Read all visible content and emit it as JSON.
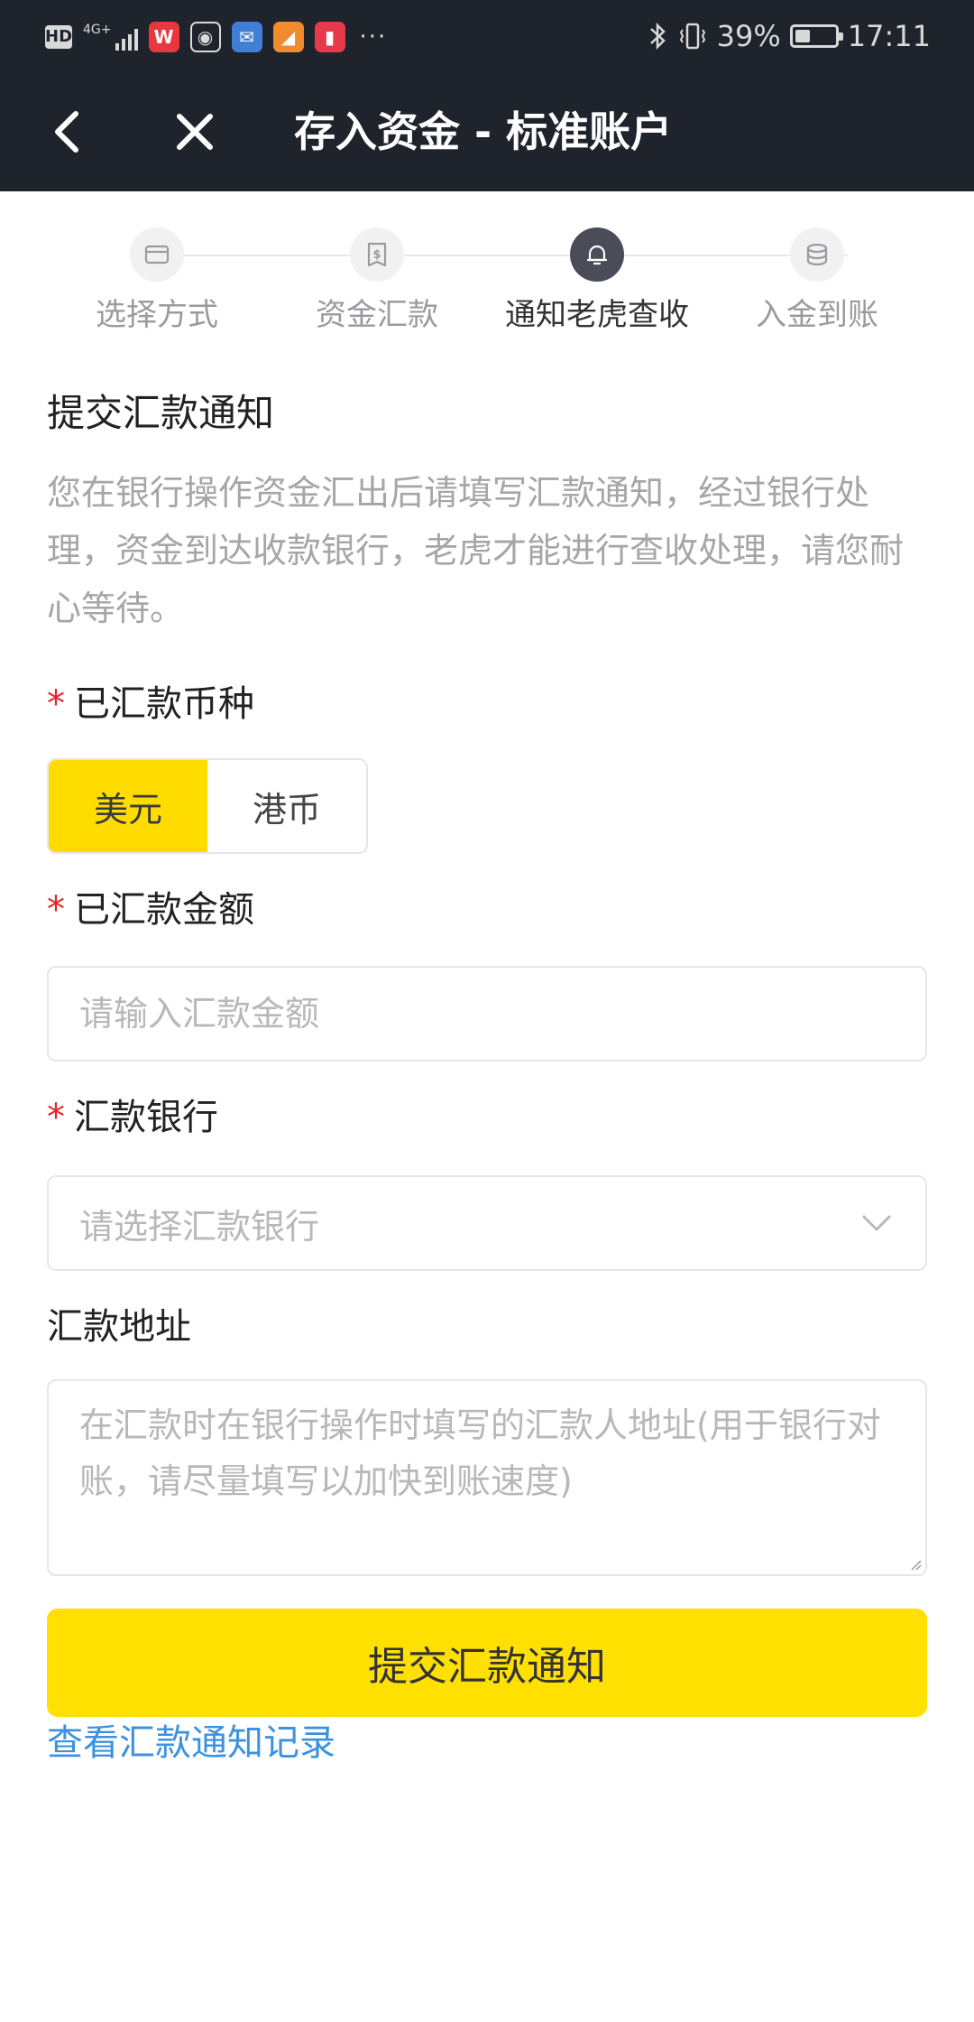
{
  "status_bar": {
    "hd": "HD",
    "network": "4G+",
    "apps": [
      {
        "icon": "wps-app-icon",
        "glyph": "W",
        "color": "#e8383d"
      },
      {
        "icon": "browser-app-icon",
        "glyph": "◉",
        "color": "#1f232b"
      },
      {
        "icon": "mail-app-icon",
        "glyph": "✉",
        "color": "#3f7fd6"
      },
      {
        "icon": "orange-app-icon",
        "glyph": "◢",
        "color": "#f28a2e"
      },
      {
        "icon": "book-app-icon",
        "glyph": "▮",
        "color": "#e63a4a"
      }
    ],
    "more": "···",
    "battery_percent": "39%",
    "battery_level": 0.39,
    "time": "17:11"
  },
  "nav": {
    "back_icon": "chevron-left-icon",
    "close_icon": "close-icon",
    "title": "存入资金 - 标准账户"
  },
  "steps": [
    {
      "label": "选择方式",
      "icon": "card-icon",
      "active": false
    },
    {
      "label": "资金汇款",
      "icon": "dollar-doc-icon",
      "active": false
    },
    {
      "label": "通知老虎查收",
      "icon": "bell-icon",
      "active": true
    },
    {
      "label": "入金到账",
      "icon": "coin-stack-icon",
      "active": false
    }
  ],
  "section": {
    "title": "提交汇款通知",
    "description": "您在银行操作资金汇出后请填写汇款通知，经过银行处理，资金到达收款银行，老虎才能进行查收处理，请您耐心等待。"
  },
  "form": {
    "required_mark": "*",
    "currency_label": "已汇款币种",
    "currency_options": [
      "美元",
      "港币"
    ],
    "currency_selected": "美元",
    "amount_label": "已汇款金额",
    "amount_placeholder": "请输入汇款金额",
    "bank_label": "汇款银行",
    "bank_placeholder": "请选择汇款银行",
    "address_label": "汇款地址",
    "address_placeholder": "在汇款时在银行操作时填写的汇款人地址(用于银行对账，请尽量填写以加快到账速度)"
  },
  "actions": {
    "submit": "提交汇款通知",
    "history_link": "查看汇款通知记录"
  },
  "colors": {
    "header_bg": "#1f232b",
    "accent_yellow": "#ffe000",
    "link_blue": "#3c92e0",
    "required_red": "#e0242b"
  }
}
